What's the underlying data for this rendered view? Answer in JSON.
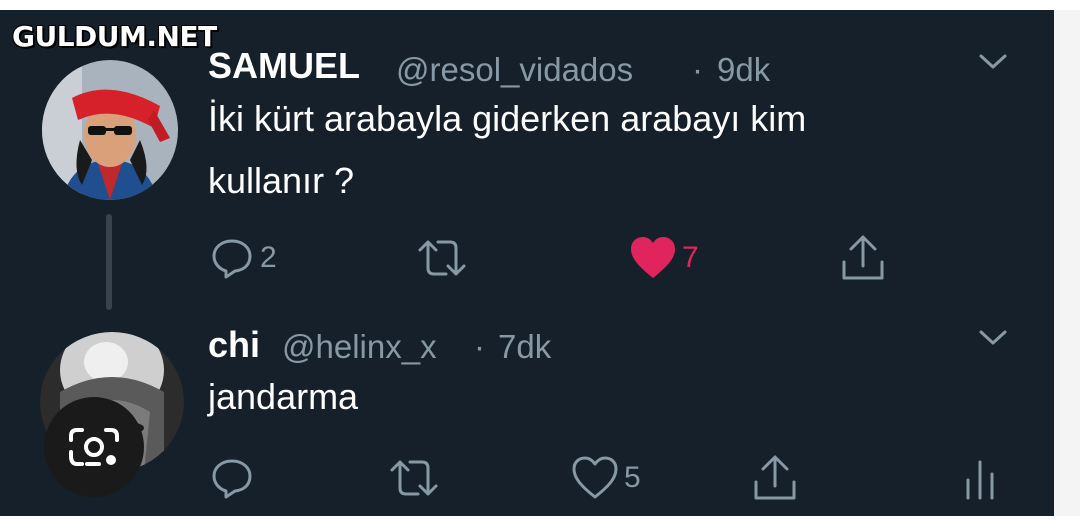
{
  "watermark": "GULDUM.NET",
  "tweets": [
    {
      "name": "SAMUEL",
      "handle": "@resol_vidados",
      "separator": "·",
      "time": "9dk",
      "text_line1": "İki kürt arabayla giderken arabayı kim",
      "text_line2": "kullanır ?",
      "reply_count": "2",
      "like_count": "7",
      "liked": true
    },
    {
      "name": "chi",
      "handle": "@helinx_x",
      "separator": "·",
      "time": "7dk",
      "text_line1": "jandarma",
      "like_count": "5",
      "liked": false
    }
  ],
  "colors": {
    "background": "#15202b",
    "secondary_text": "#8899a6",
    "like_active": "#e0245e",
    "thread_line": "#38444d"
  },
  "icons": {
    "reply": "speech-bubble-icon",
    "retweet": "retweet-arrows-icon",
    "like": "heart-icon",
    "share": "share-upload-icon",
    "analytics": "bar-chart-icon",
    "menu": "chevron-down-icon",
    "visual_search": "camera-lens-icon"
  }
}
